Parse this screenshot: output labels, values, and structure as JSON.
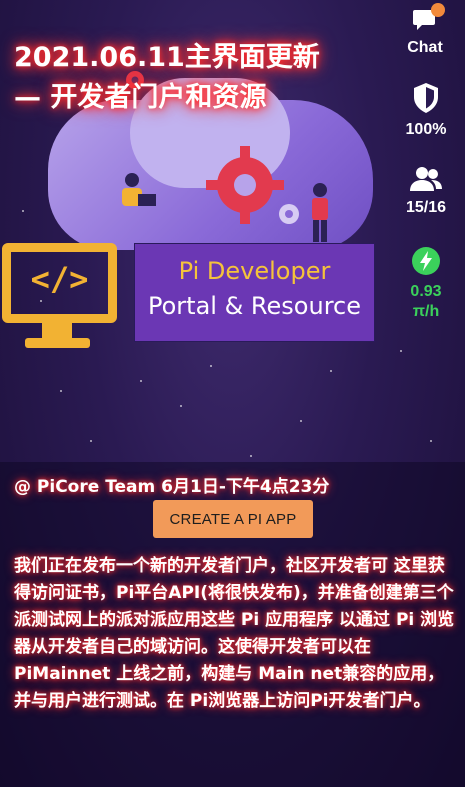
{
  "headline": {
    "line1": "2021.06.11主界面更新",
    "line2": "— 开发者门户和资源"
  },
  "rail": {
    "chat": {
      "label": "Chat",
      "icon": "chat-bubble-icon"
    },
    "security": {
      "value": "100%",
      "icon": "shield-icon"
    },
    "team": {
      "value": "15/16",
      "icon": "people-icon"
    },
    "mining": {
      "rate": "0.93",
      "unit": "π/h",
      "icon": "lightning-icon",
      "color": "#3bd15b"
    }
  },
  "banner": {
    "title_line1": "Pi Developer",
    "title_line2": "Portal & Resource"
  },
  "post": {
    "author_line": "@ PiCore Team 6月1日-下午4点23分",
    "cta_label": "CREATE A PI APP",
    "body": "我们正在发布一个新的开发者门户，社区开发者可 这里获得访问证书，Pi平台API(将很快发布)，并准备创建第三个派测试网上的派对派应用这些 Pi 应用程序 以通过 Pi 浏览器从开发者自己的域访问。这使得开发者可以在PiMainnet 上线之前，构建与 Main net兼容的应用，并与用户进行测试。在 Pi浏览器上访问Pi开发者门户。"
  },
  "colors": {
    "glow": "#ff2a2a",
    "button": "#f29a59",
    "banner_bg": "#6b37b4",
    "banner_title": "#f5c33b",
    "monitor": "#f2b233"
  }
}
